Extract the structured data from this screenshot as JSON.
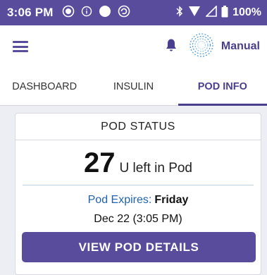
{
  "status_bar": {
    "time": "3:06 PM",
    "left_icons": [
      "record-icon",
      "info-icon",
      "circle-icon",
      "sync-icon"
    ],
    "right_icons": [
      "bluetooth-icon",
      "wifi-icon",
      "signal-icon",
      "battery-icon"
    ],
    "battery": "100%"
  },
  "app_bar": {
    "menu_icon": "hamburger-icon",
    "notification_icon": "bell-icon",
    "mode_icon": "pod-status-icon",
    "mode_label": "Manual"
  },
  "tabs": [
    {
      "label": "DASHBOARD",
      "active": false
    },
    {
      "label": "INSULIN",
      "active": false
    },
    {
      "label": "POD INFO",
      "active": true
    }
  ],
  "pod_status": {
    "title": "POD STATUS",
    "units_left": "27",
    "units_text": "U left in Pod",
    "expires_label": "Pod Expires:",
    "expires_day": "Friday",
    "expires_date": "Dec 22 (3:05 PM)",
    "button_label": "VIEW POD DETAILS"
  },
  "colors": {
    "primary": "#5a4c9d",
    "accent_text": "#4a3e8f",
    "link_blue": "#1f62b0"
  }
}
